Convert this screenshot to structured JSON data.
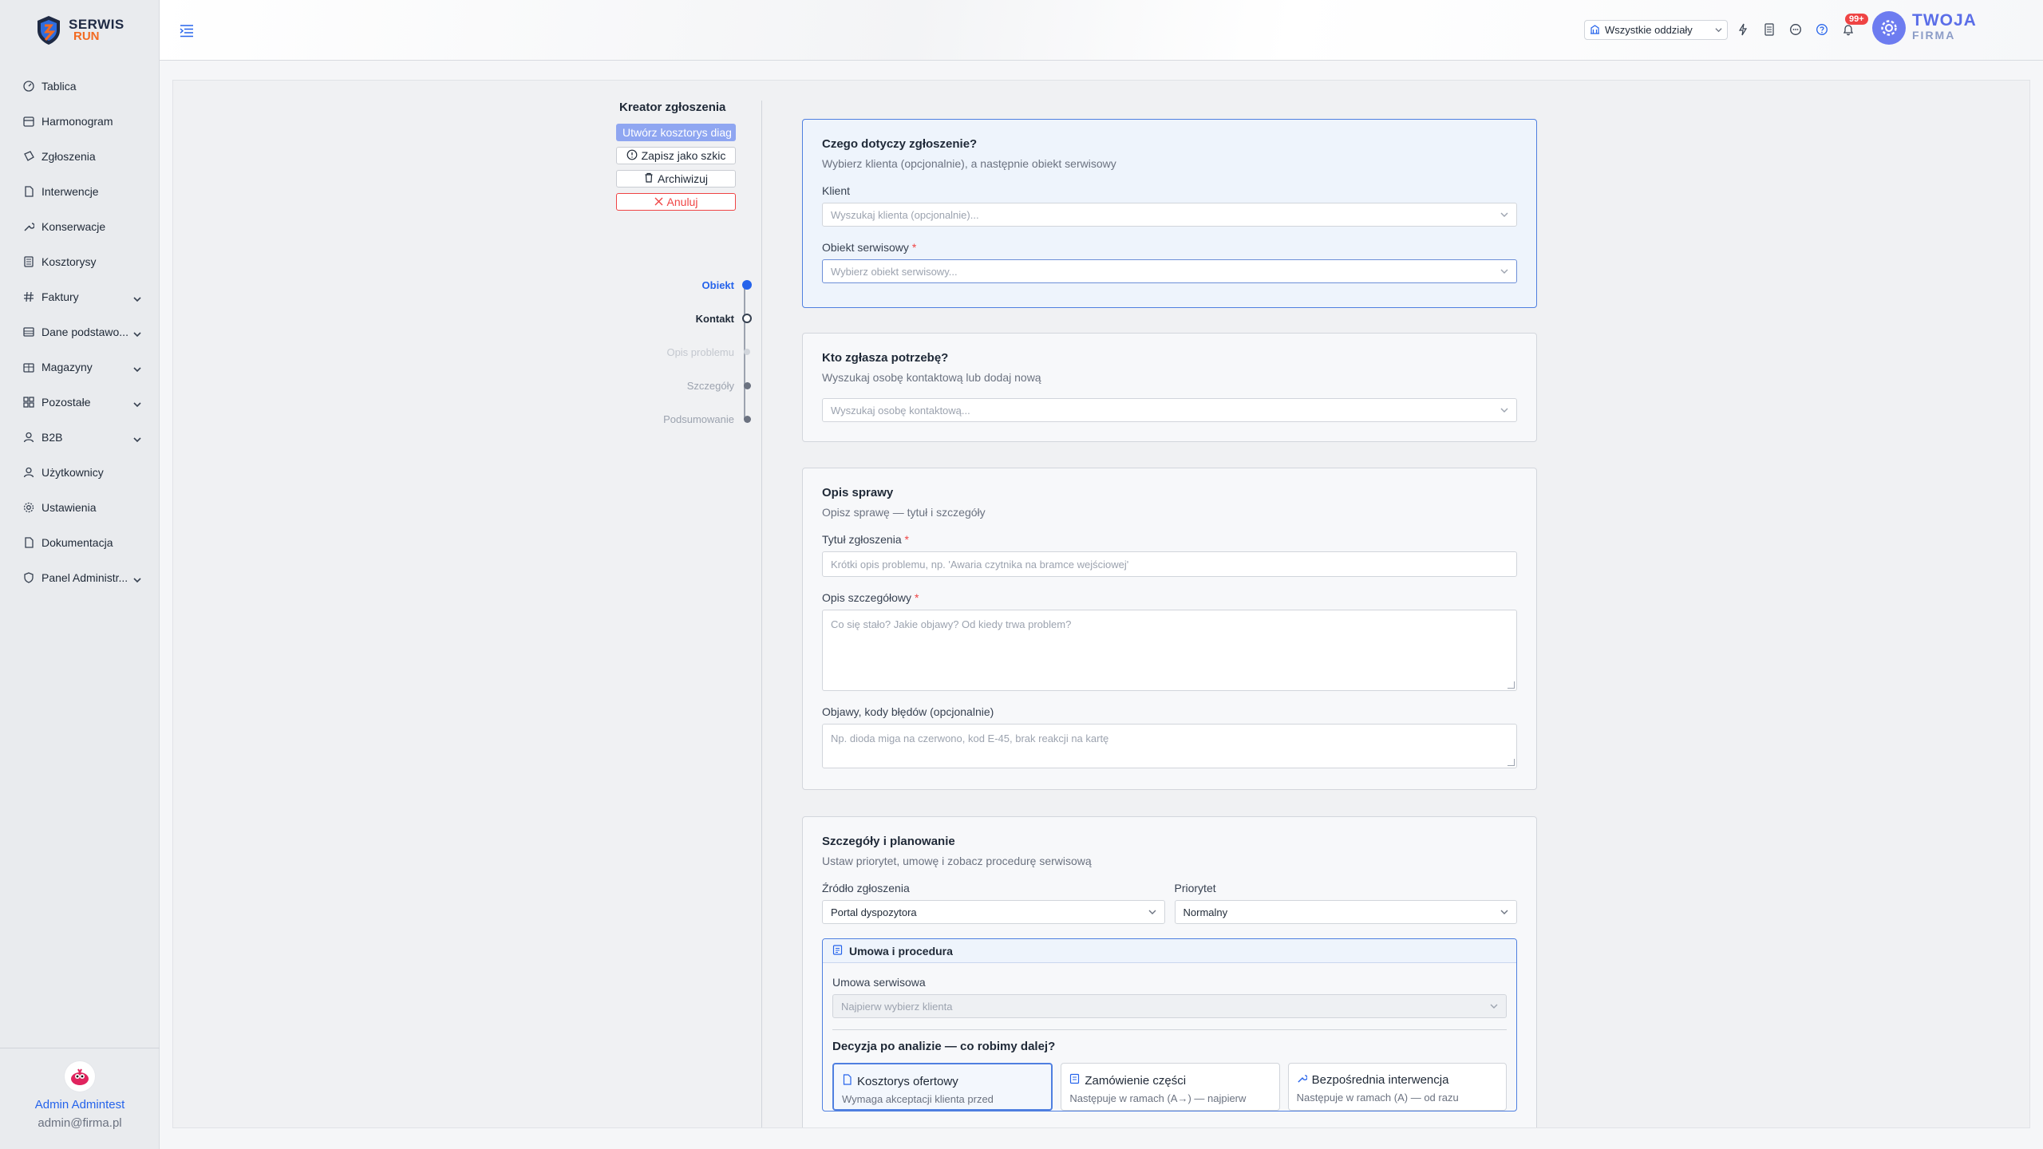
{
  "brand": {
    "logo_line1": "SERWIS",
    "logo_line2": "RUN"
  },
  "sidebar": {
    "items": [
      {
        "label": "Tablica",
        "icon": "dashboard-icon",
        "expandable": false
      },
      {
        "label": "Harmonogram",
        "icon": "calendar-icon",
        "expandable": false
      },
      {
        "label": "Zgłoszenia",
        "icon": "ticket-icon",
        "expandable": false
      },
      {
        "label": "Interwencje",
        "icon": "document-icon",
        "expandable": false
      },
      {
        "label": "Konserwacje",
        "icon": "wrench-icon",
        "expandable": false
      },
      {
        "label": "Kosztorysy",
        "icon": "calculator-icon",
        "expandable": false
      },
      {
        "label": "Faktury",
        "icon": "hash-icon",
        "expandable": true
      },
      {
        "label": "Dane podstawo...",
        "icon": "database-icon",
        "expandable": true
      },
      {
        "label": "Magazyny",
        "icon": "warehouse-icon",
        "expandable": true
      },
      {
        "label": "Pozostałe",
        "icon": "grid-icon",
        "expandable": true
      },
      {
        "label": "B2B",
        "icon": "user-icon",
        "expandable": true
      },
      {
        "label": "Użytkownicy",
        "icon": "user-icon",
        "expandable": false
      },
      {
        "label": "Ustawienia",
        "icon": "gear-icon",
        "expandable": false
      },
      {
        "label": "Dokumentacja",
        "icon": "document-icon",
        "expandable": false
      },
      {
        "label": "Panel Administr...",
        "icon": "shield-icon",
        "expandable": true
      }
    ],
    "user": {
      "name": "Admin Admintest",
      "email": "admin@firma.pl"
    }
  },
  "topbar": {
    "branch_select": "Wszystkie oddziały",
    "notifications_badge": "99+",
    "company_line1": "TWOJA",
    "company_line2": "FIRMA"
  },
  "wizard": {
    "title": "Kreator zgłoszenia",
    "buttons": {
      "create_estimate": "Utwórz kosztorys diag",
      "save_draft": "Zapisz jako szkic",
      "archive": "Archiwizuj",
      "cancel": "Anuluj"
    },
    "steps": [
      {
        "label": "Obiekt",
        "state": "active"
      },
      {
        "label": "Kontakt",
        "state": "current"
      },
      {
        "label": "Opis problemu",
        "state": "disabled"
      },
      {
        "label": "Szczegóły",
        "state": "pending"
      },
      {
        "label": "Podsumowanie",
        "state": "pending"
      }
    ]
  },
  "cards": {
    "object": {
      "title": "Czego dotyczy zgłoszenie?",
      "subtitle": "Wybierz klienta (opcjonalnie), a następnie obiekt serwisowy",
      "client_label": "Klient",
      "client_placeholder": "Wyszukaj klienta (opcjonalnie)...",
      "object_label": "Obiekt serwisowy",
      "object_placeholder": "Wybierz obiekt serwisowy..."
    },
    "contact": {
      "title": "Kto zgłasza potrzebę?",
      "subtitle": "Wyszukaj osobę kontaktową lub dodaj nową",
      "contact_placeholder": "Wyszukaj osobę kontaktową..."
    },
    "description": {
      "title": "Opis sprawy",
      "subtitle": "Opisz sprawę — tytuł i szczegóły",
      "title_label": "Tytuł zgłoszenia",
      "title_placeholder": "Krótki opis problemu, np. 'Awaria czytnika na bramce wejściowej'",
      "details_label": "Opis szczegółowy",
      "details_placeholder": "Co się stało? Jakie objawy? Od kiedy trwa problem?",
      "symptoms_label": "Objawy, kody błędów (opcjonalnie)",
      "symptoms_placeholder": "Np. dioda miga na czerwono, kod E-45, brak reakcji na kartę"
    },
    "details": {
      "title": "Szczegóły i planowanie",
      "subtitle": "Ustaw priorytet, umowę i zobacz procedurę serwisową",
      "source_label": "Źródło zgłoszenia",
      "source_value": "Portal dyspozytora",
      "priority_label": "Priorytet",
      "priority_value": "Normalny",
      "procedure_title": "Umowa i procedura",
      "contract_label": "Umowa serwisowa",
      "contract_placeholder": "Najpierw wybierz klienta",
      "decision_title": "Decyzja po analizie — co robimy dalej?",
      "options": [
        {
          "label": "Kosztorys ofertowy",
          "desc": "Wymaga akceptacji klienta przed",
          "icon": "document-icon"
        },
        {
          "label": "Zamówienie części",
          "desc": "Następuje w ramach (A→) — najpierw",
          "icon": "order-icon"
        },
        {
          "label": "Bezpośrednia interwencja",
          "desc": "Następuje w ramach (A) — od razu",
          "icon": "wrench-icon"
        }
      ]
    }
  },
  "colors": {
    "accent": "#2563eb",
    "active_border": "#4f7fe0",
    "danger": "#ef4444",
    "brand_orange": "#f26a21",
    "company_blue": "#5b6ee8"
  }
}
